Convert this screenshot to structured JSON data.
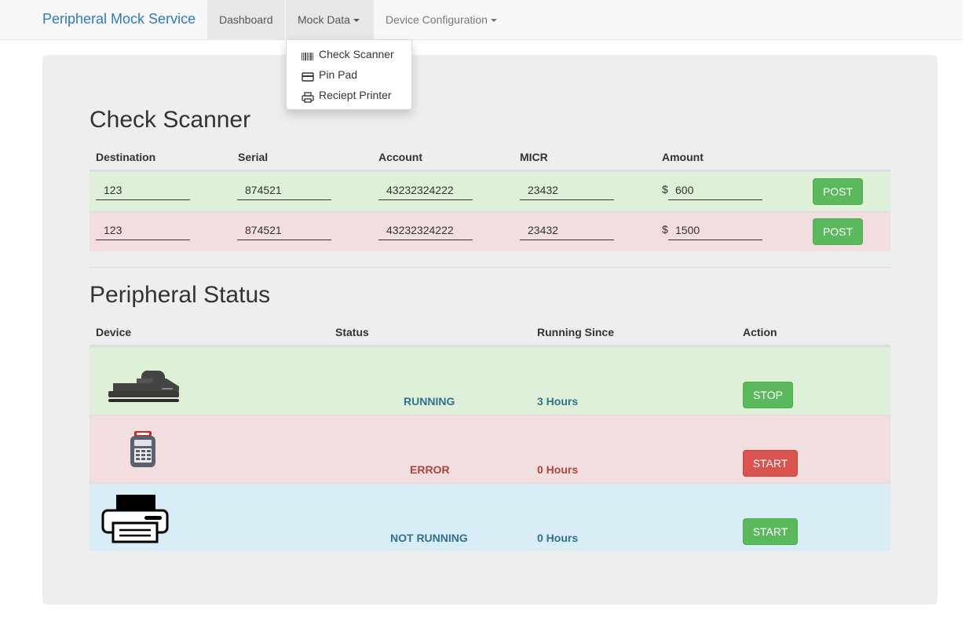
{
  "navbar": {
    "brand": "Peripheral Mock Service",
    "items": [
      {
        "label": "Dashboard"
      },
      {
        "label": "Mock Data"
      },
      {
        "label": "Device Configuration"
      }
    ]
  },
  "dropdown": {
    "items": [
      {
        "label": "Check Scanner",
        "icon": "barcode-icon"
      },
      {
        "label": "Pin Pad",
        "icon": "credit-card-icon"
      },
      {
        "label": "Reciept Printer",
        "icon": "print-icon"
      }
    ]
  },
  "check_scanner": {
    "title": "Check Scanner",
    "columns": [
      "Destination",
      "Serial",
      "Account",
      "MICR",
      "Amount"
    ],
    "currency": "$",
    "rows": [
      {
        "destination": "123",
        "serial": "874521",
        "account": "43232324222",
        "micr": "23432",
        "amount": "600",
        "button": "POST",
        "state": "success"
      },
      {
        "destination": "123",
        "serial": "874521",
        "account": "43232324222",
        "micr": "23432",
        "amount": "1500",
        "button": "POST",
        "state": "danger"
      }
    ]
  },
  "peripheral_status": {
    "title": "Peripheral Status",
    "columns": [
      "Device",
      "Status",
      "Running Since",
      "Action"
    ],
    "rows": [
      {
        "device_icon": "check-scanner-icon",
        "status": "RUNNING",
        "running_since": "3 Hours",
        "action": "STOP",
        "state": "success"
      },
      {
        "device_icon": "pin-pad-icon",
        "status": "ERROR",
        "running_since": "0 Hours",
        "action": "START",
        "state": "danger"
      },
      {
        "device_icon": "receipt-printer-icon",
        "status": "NOT RUNNING",
        "running_since": "0 Hours",
        "action": "START",
        "state": "info"
      }
    ]
  },
  "colors": {
    "brand": "#337ab7",
    "success_row": "#dff0d8",
    "danger_row": "#f2dede",
    "info_row": "#d9edf7",
    "btn_success": "#5cb85c",
    "btn_danger": "#d9534f"
  }
}
